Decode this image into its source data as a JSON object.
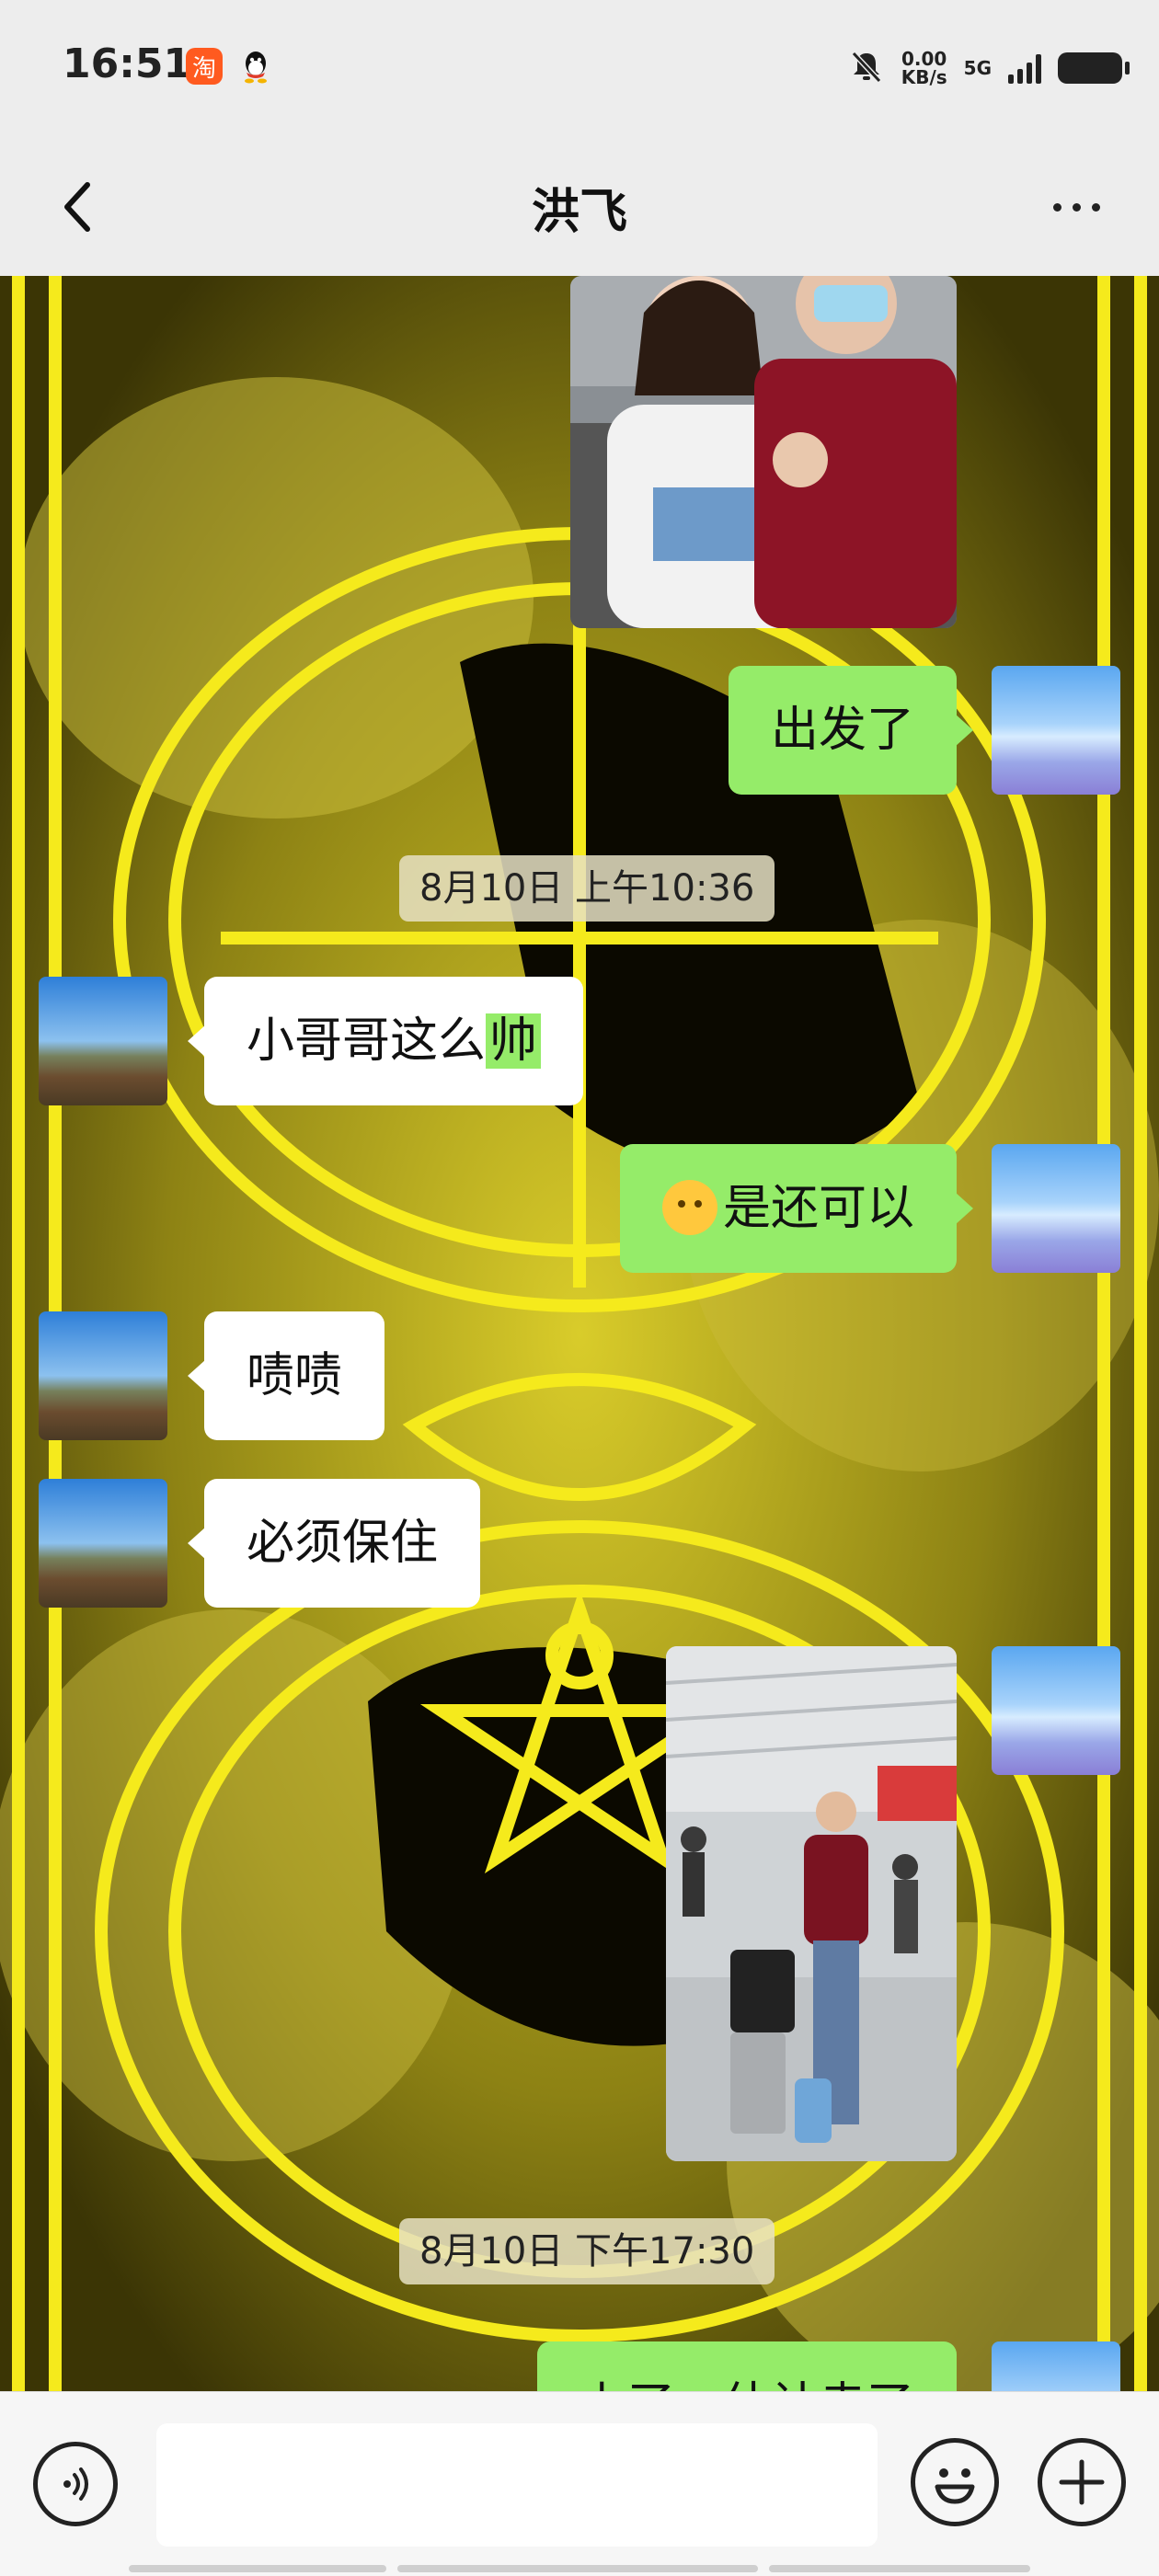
{
  "status_bar": {
    "time": "16:51",
    "apps": [
      "taobao-icon",
      "qq-icon"
    ],
    "taobao_glyph": "淘",
    "speed_value": "0.00",
    "speed_unit": "KB/s",
    "network": "5G",
    "icons": [
      "bell-muted-icon",
      "signal-icon",
      "battery-icon"
    ]
  },
  "title_bar": {
    "title": "洪飞",
    "back_icon": "chevron-left-icon",
    "more_icon": "more-icon"
  },
  "chat": {
    "background": "yellow-black-magic-circle",
    "messages": [
      {
        "type": "image",
        "side": "right",
        "description_icon": "photo-couple"
      },
      {
        "type": "text",
        "side": "right",
        "text": "出发了"
      },
      {
        "type": "timestamp",
        "text": "8月10日 上午10:36"
      },
      {
        "type": "text",
        "side": "left",
        "text_before": "小哥哥这么",
        "text_highlight": "帅"
      },
      {
        "type": "text",
        "side": "right",
        "emoji": "blush-face",
        "text": "是还可以"
      },
      {
        "type": "text",
        "side": "left",
        "text": "啧啧"
      },
      {
        "type": "text",
        "side": "left",
        "text": "必须保住"
      },
      {
        "type": "image",
        "side": "right",
        "description_icon": "photo-station"
      },
      {
        "type": "timestamp",
        "text": "8月10日 下午17:30"
      },
      {
        "type": "text",
        "side": "right",
        "text": "上了，估计走了",
        "partially_visible": true
      }
    ]
  },
  "input_bar": {
    "voice_icon": "voice-icon",
    "emoji_icon": "emoji-icon",
    "plus_icon": "plus-icon",
    "input_value": ""
  },
  "colors": {
    "sent_bubble": "#95ec69",
    "received_bubble": "#ffffff",
    "bar_background": "#ededed"
  }
}
